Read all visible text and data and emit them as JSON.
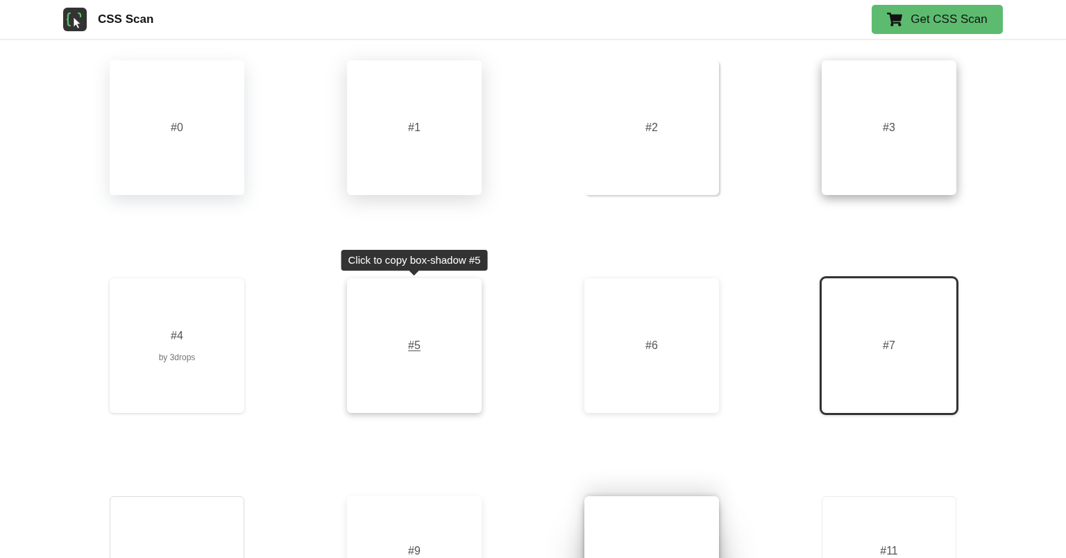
{
  "header": {
    "brand": "CSS Scan",
    "cta": "Get CSS Scan"
  },
  "shadow_cards": [
    {
      "label": "#0",
      "kind": "soft-glow",
      "hovered": false
    },
    {
      "label": "#1",
      "kind": "wide-glow",
      "hovered": false
    },
    {
      "label": "#2",
      "kind": "corner-offset",
      "hovered": false
    },
    {
      "label": "#3",
      "kind": "deep-drop",
      "hovered": false
    },
    {
      "label": "#4",
      "credit": "by 3drops",
      "kind": "thin-outline",
      "hovered": false
    },
    {
      "label": "#5",
      "kind": "close-drop",
      "hovered": true,
      "tooltip": "Click to copy box-shadow #5"
    },
    {
      "label": "#6",
      "kind": "soft-outline",
      "hovered": false
    },
    {
      "label": "#7",
      "kind": "dark-border",
      "hovered": false
    },
    {
      "kind": "hairline-border"
    },
    {
      "label": "#9",
      "kind": "light-drop",
      "hovered": false
    },
    {
      "kind": "heavy-drop"
    },
    {
      "label": "#11",
      "kind": "faint-border",
      "hovered": false
    }
  ]
}
